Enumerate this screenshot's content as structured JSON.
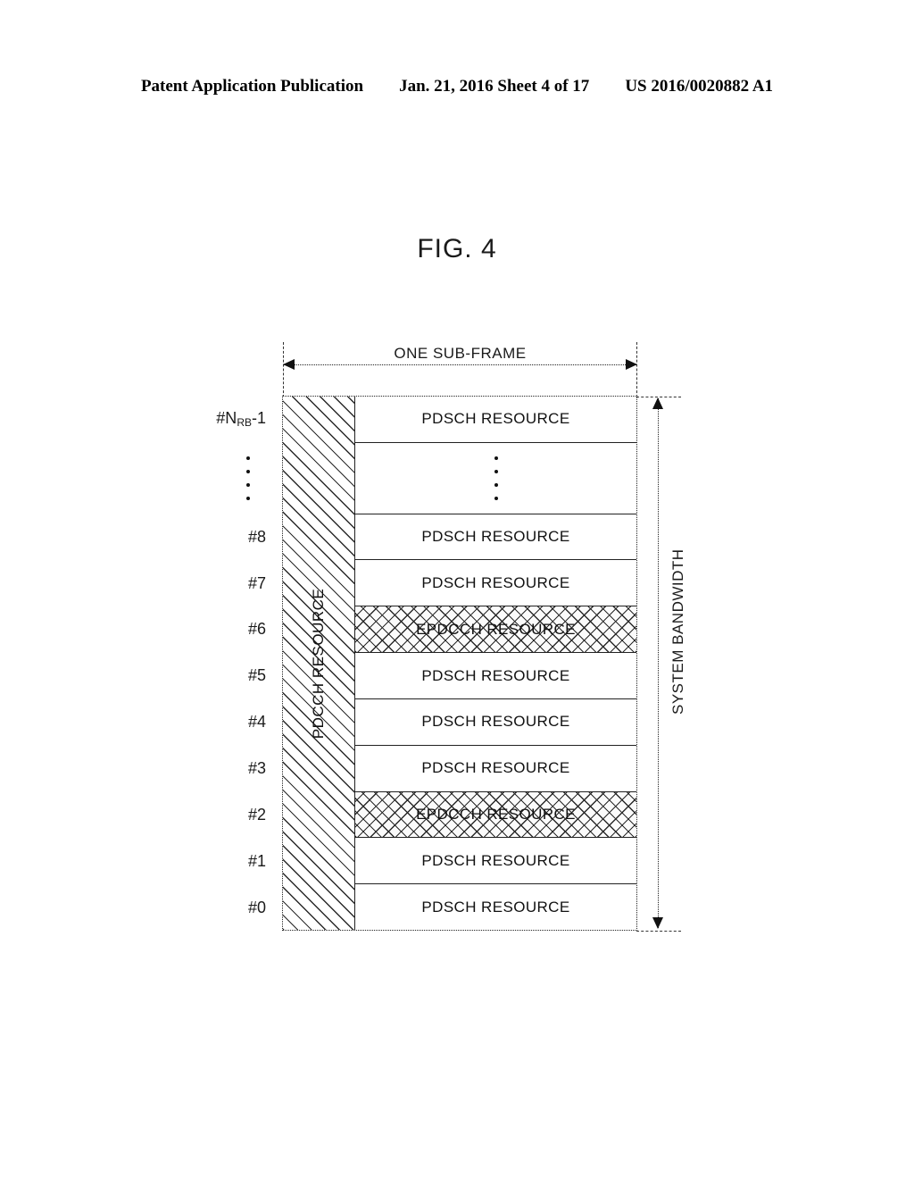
{
  "header": {
    "publication": "Patent Application Publication",
    "date_sheet": "Jan. 21, 2016  Sheet 4 of 17",
    "patent_number": "US 2016/0020882 A1"
  },
  "figure": {
    "title": "FIG. 4",
    "horizontal_axis_label": "ONE SUB-FRAME",
    "vertical_axis_label": "SYSTEM BANDWIDTH",
    "control_column_label": "PDCCH RESOURCE",
    "labels": {
      "pdsch": "PDSCH RESOURCE",
      "epdcch": "EPDCCH RESOURCE"
    },
    "row_label_top": "#N",
    "row_label_top_sub": "RB",
    "row_label_top_suffix": "-1",
    "row_labels": [
      "#8",
      "#7",
      "#6",
      "#5",
      "#4",
      "#3",
      "#2",
      "#1",
      "#0"
    ],
    "rows": [
      {
        "index_label": "#NRB-1",
        "type": "pdsch",
        "text": "PDSCH RESOURCE"
      },
      {
        "index_label": "dots",
        "type": "dots",
        "text": ""
      },
      {
        "index_label": "#8",
        "type": "pdsch",
        "text": "PDSCH RESOURCE"
      },
      {
        "index_label": "#7",
        "type": "pdsch",
        "text": "PDSCH RESOURCE"
      },
      {
        "index_label": "#6",
        "type": "epdcch",
        "text": "EPDCCH RESOURCE"
      },
      {
        "index_label": "#5",
        "type": "pdsch",
        "text": "PDSCH RESOURCE"
      },
      {
        "index_label": "#4",
        "type": "pdsch",
        "text": "PDSCH RESOURCE"
      },
      {
        "index_label": "#3",
        "type": "pdsch",
        "text": "PDSCH RESOURCE"
      },
      {
        "index_label": "#2",
        "type": "epdcch",
        "text": "EPDCCH RESOURCE"
      },
      {
        "index_label": "#1",
        "type": "pdsch",
        "text": "PDSCH RESOURCE"
      },
      {
        "index_label": "#0",
        "type": "pdsch",
        "text": "PDSCH RESOURCE"
      }
    ],
    "colors": {
      "line": "#222222",
      "text": "#111111",
      "background": "#ffffff",
      "hatch": "#2a2a2a"
    }
  }
}
